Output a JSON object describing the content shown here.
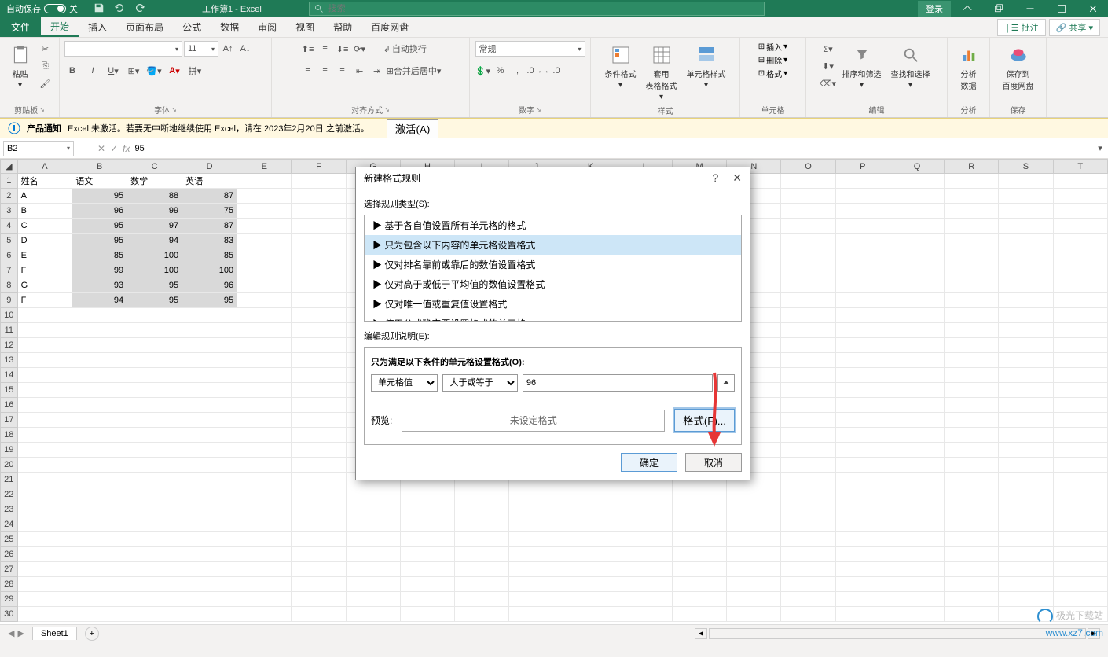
{
  "titlebar": {
    "autosave": "自动保存",
    "autosave_state": "关",
    "title": "工作簿1  -  Excel",
    "search_ph": "搜索",
    "login": "登录"
  },
  "tabs": {
    "file": "文件",
    "items": [
      "开始",
      "插入",
      "页面布局",
      "公式",
      "数据",
      "审阅",
      "视图",
      "帮助",
      "百度网盘"
    ],
    "active": 0,
    "comment": "批注",
    "share": "共享"
  },
  "groups": {
    "clipboard": "剪贴板",
    "paste": "粘贴",
    "font": "字体",
    "fontname": "",
    "fontsize": "11",
    "align": "对齐方式",
    "wrap": "自动换行",
    "merge": "合并后居中",
    "number": "数字",
    "numfmt": "常规",
    "styles": "样式",
    "cond": "条件格式",
    "tblfmt": "套用\n表格格式",
    "cellstyle": "单元格样式",
    "cells": "单元格",
    "insert": "插入",
    "delete": "删除",
    "format": "格式",
    "editing": "编辑",
    "sortfilter": "排序和筛选",
    "find": "查找和选择",
    "analysis": "分析",
    "analyzedata": "分析\n数据",
    "save_group": "保存",
    "baidu": "保存到\n百度网盘"
  },
  "notice": {
    "title": "产品通知",
    "body": "Excel 未激活。若要无中断地继续使用 Excel，请在 2023年2月20日 之前激活。",
    "btn": "激活(A)"
  },
  "namebox": {
    "ref": "B2",
    "formula": "95"
  },
  "sheet": {
    "cols": [
      "A",
      "B",
      "C",
      "D",
      "E",
      "F",
      "G",
      "H",
      "I",
      "J",
      "K",
      "L",
      "M",
      "N",
      "O",
      "P",
      "Q",
      "R",
      "S",
      "T"
    ],
    "rows": 30,
    "headers": [
      "姓名",
      "语文",
      "数学",
      "英语"
    ],
    "data": [
      [
        "A",
        "95",
        "88",
        "87"
      ],
      [
        "B",
        "96",
        "99",
        "75"
      ],
      [
        "C",
        "95",
        "97",
        "87"
      ],
      [
        "D",
        "95",
        "94",
        "83"
      ],
      [
        "E",
        "85",
        "100",
        "85"
      ],
      [
        "F",
        "99",
        "100",
        "100"
      ],
      [
        "G",
        "93",
        "95",
        "96"
      ],
      [
        "F",
        "94",
        "95",
        "95"
      ]
    ]
  },
  "sheettab": {
    "name": "Sheet1"
  },
  "dialog": {
    "title": "新建格式规则",
    "help": "?",
    "close": "✕",
    "select_label": "选择规则类型(S):",
    "rules": [
      "▶ 基于各自值设置所有单元格的格式",
      "▶ 只为包含以下内容的单元格设置格式",
      "▶ 仅对排名靠前或靠后的数值设置格式",
      "▶ 仅对高于或低于平均值的数值设置格式",
      "▶ 仅对唯一值或重复值设置格式",
      "▶ 使用公式确定要设置格式的单元格"
    ],
    "selected_rule": 1,
    "edit_label": "编辑规则说明(E):",
    "cond_label": "只为满足以下条件的单元格设置格式(O):",
    "sel1": "单元格值",
    "sel2": "大于或等于",
    "val": "96",
    "preview_label": "预览:",
    "preview_text": "未设定格式",
    "format_btn": "格式(F)...",
    "ok": "确定",
    "cancel": "取消"
  },
  "watermark": {
    "brand": "极光下载站",
    "url": "www.xz7.com"
  }
}
